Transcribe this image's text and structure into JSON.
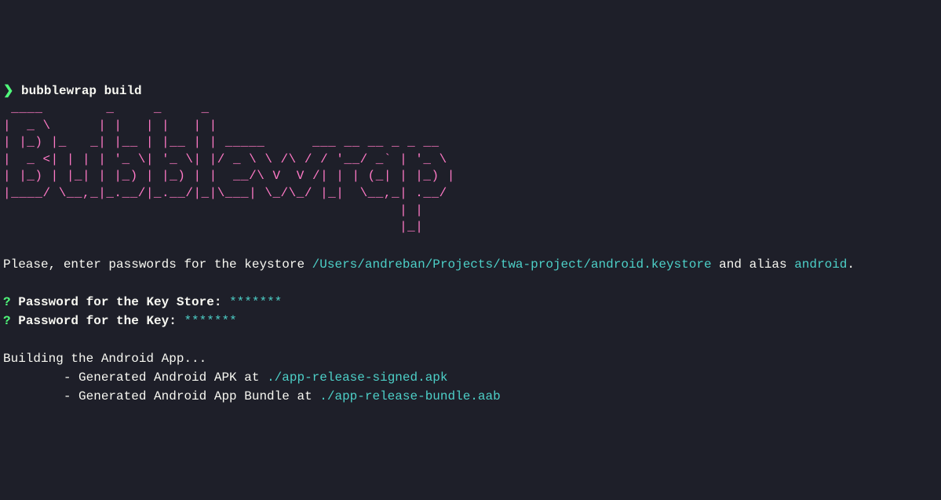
{
  "prompt": {
    "symbol": "❯",
    "command": "bubblewrap build"
  },
  "ascii_art": " ____        _     _     _                                \n|  _ \\      | |   | |   | |                               \n| |_) |_   _| |__ | |__ | | _____      ___ __ __ _ _ __   \n|  _ <| | | | '_ \\| '_ \\| |/ _ \\ \\ /\\ / / '__/ _` | '_ \\  \n| |_) | |_| | |_) | |_) | |  __/\\ V  V /| | | (_| | |_) | \n|____/ \\__,_|_.__/|_.__/|_|\\___| \\_/\\_/ |_|  \\__,_| .__/  \n                                                  | |     \n                                                  |_|     ",
  "keystore_prompt": {
    "prefix": "Please, enter passwords for the keystore ",
    "keystore_path": "/Users/andreban/Projects/twa-project/android.keystore",
    "middle": " and alias ",
    "alias": "android",
    "suffix": "."
  },
  "questions": {
    "q1": {
      "symbol": "?",
      "label": " Password for the Key Store: ",
      "value": "*******"
    },
    "q2": {
      "symbol": "?",
      "label": " Password for the Key: ",
      "value": "*******"
    }
  },
  "building": {
    "title": "Building the Android App...",
    "line1_prefix": "        - Generated Android APK at ",
    "line1_path": "./app-release-signed.apk",
    "line2_prefix": "        - Generated Android App Bundle at ",
    "line2_path": "./app-release-bundle.aab"
  }
}
